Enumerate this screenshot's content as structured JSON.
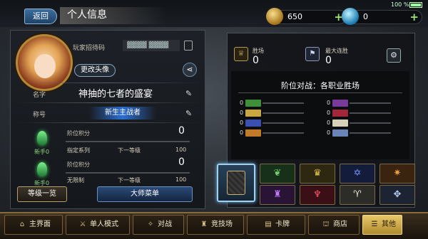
{
  "status": {
    "battery": "100 %"
  },
  "header": {
    "back_label": "返回",
    "title": "个人信息",
    "gold": "650",
    "crystals": "0",
    "plus": "+"
  },
  "profile": {
    "invite_label": "玩家招待码",
    "invite_code": "▓▓▓▓ ▓▓▓▓",
    "change_avatar": "更改头像",
    "name_label": "名字",
    "player_name": "神抽的七者的盛宴",
    "title_label": "称号",
    "title_value": "新生主战者",
    "rank_rows": [
      {
        "tier": "新手0",
        "points_label": "阶位积分",
        "points": "0",
        "series": "指定系列",
        "next_label": "下一等级",
        "next_value": "100"
      },
      {
        "tier": "新手0",
        "points_label": "阶位积分",
        "points": "0",
        "series": "无限制",
        "next_label": "下一等级",
        "next_value": "100"
      }
    ],
    "rank_list_button": "等级一览",
    "master_menu_button": "大师菜单"
  },
  "stats": {
    "wins_label": "胜场",
    "wins_value": "0",
    "max_streak_label": "最大连胜",
    "max_streak_value": "0",
    "class_wins_title": "阶位对战：各职业胜场",
    "class_wins": [
      {
        "count": "0",
        "icon": "leaf-icon",
        "color": "#3f8f3a"
      },
      {
        "count": "0",
        "icon": "crown-icon",
        "color": "#c9a640"
      },
      {
        "count": "0",
        "icon": "pentagram-icon",
        "color": "#3a4fb0"
      },
      {
        "count": "0",
        "icon": "dragon-icon",
        "color": "#c07a2a"
      },
      {
        "count": "0",
        "icon": "necro-icon",
        "color": "#7a3a9a"
      },
      {
        "count": "0",
        "icon": "bat-icon",
        "color": "#a0283a"
      },
      {
        "count": "0",
        "icon": "wings-icon",
        "color": "#d8d0b8"
      },
      {
        "count": "0",
        "icon": "nemesis-icon",
        "color": "#6a84b8"
      }
    ]
  },
  "class_tiles": [
    {
      "icon": "leaf-icon",
      "glyph": "❦",
      "bg": "#17301a",
      "fg": "#6fd06a"
    },
    {
      "icon": "crown-icon",
      "glyph": "♛",
      "bg": "#2f2810",
      "fg": "#e6c150"
    },
    {
      "icon": "pentagram-icon",
      "glyph": "✡",
      "bg": "#141c3c",
      "fg": "#7a9aff"
    },
    {
      "icon": "dragon-icon",
      "glyph": "✷",
      "bg": "#3a2410",
      "fg": "#f0a040"
    },
    {
      "icon": "necro-icon",
      "glyph": "♜",
      "bg": "#2a1436",
      "fg": "#c27aff"
    },
    {
      "icon": "bat-icon",
      "glyph": "♆",
      "bg": "#3a1016",
      "fg": "#ff5a6a"
    },
    {
      "icon": "wings-icon",
      "glyph": "♈",
      "bg": "#2c2c28",
      "fg": "#f0ead8"
    },
    {
      "icon": "nemesis-icon",
      "glyph": "✥",
      "bg": "#1c2434",
      "fg": "#b8c8f0"
    }
  ],
  "nav": [
    {
      "label": "主界面",
      "icon": "house-icon",
      "glyph": "⌂"
    },
    {
      "label": "单人模式",
      "icon": "sword-icon",
      "glyph": "⚔"
    },
    {
      "label": "对战",
      "icon": "battle-icon",
      "glyph": "✧"
    },
    {
      "label": "竞技场",
      "icon": "arena-icon",
      "glyph": "♜"
    },
    {
      "label": "卡牌",
      "icon": "cards-icon",
      "glyph": "▤"
    },
    {
      "label": "商店",
      "icon": "shop-icon",
      "glyph": "⛫"
    },
    {
      "label": "其他",
      "icon": "menu-icon",
      "glyph": "☰"
    }
  ]
}
